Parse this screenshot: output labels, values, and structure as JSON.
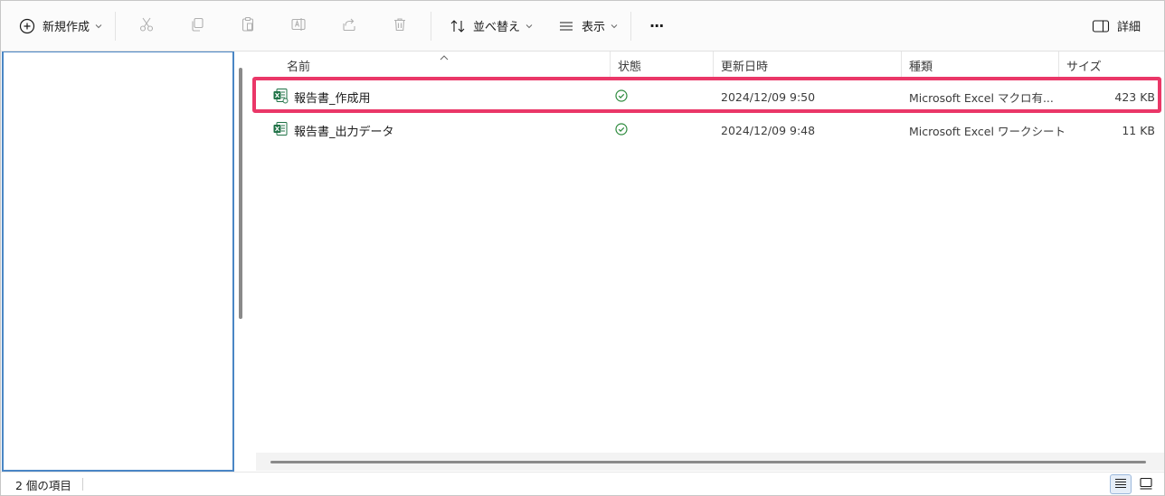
{
  "toolbar": {
    "new_label": "新規作成",
    "sort_label": "並べ替え",
    "view_label": "表示",
    "more_label": "···",
    "details_label": "詳細"
  },
  "columns": {
    "name": "名前",
    "status": "状態",
    "modified": "更新日時",
    "type": "種類",
    "size": "サイズ"
  },
  "files": [
    {
      "name": "報告書_作成用",
      "modified": "2024/12/09 9:50",
      "type": "Microsoft Excel マクロ有...",
      "size": "423 KB"
    },
    {
      "name": "報告書_出力データ",
      "modified": "2024/12/09 9:48",
      "type": "Microsoft Excel ワークシート",
      "size": "11 KB"
    }
  ],
  "statusbar": {
    "count": "2 個の項目"
  },
  "colors": {
    "highlight": "#ea3768",
    "selection_border": "#4a86c5",
    "excel_green": "#1e7145",
    "status_green": "#2e8b3e"
  }
}
